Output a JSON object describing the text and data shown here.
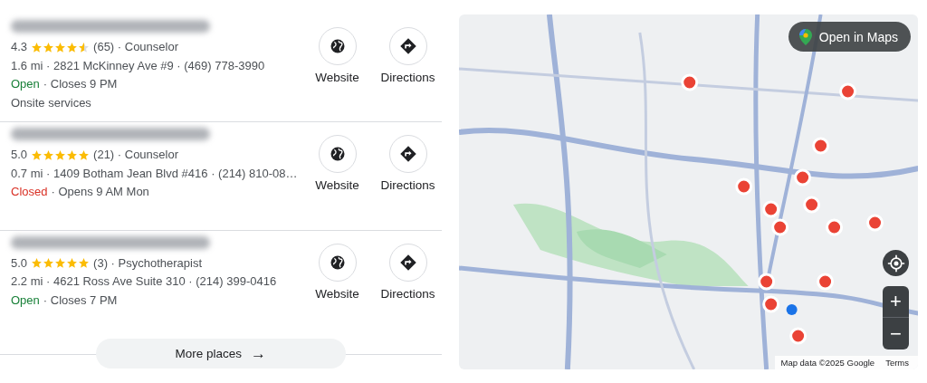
{
  "places": [
    {
      "rating": "4.3",
      "stars": 4.5,
      "reviews": "(65) · Counselor",
      "details": "1.6 mi · 2821 McKinney Ave #9 · (469) 778-3990",
      "open": true,
      "status": "Open",
      "hours": "· Closes 9 PM",
      "extra": "Onsite services",
      "actions": [
        "Website",
        "Directions"
      ]
    },
    {
      "rating": "5.0",
      "stars": 5,
      "reviews": "(21) · Counselor",
      "details": "0.7 mi · 1409 Botham Jean Blvd #416 · (214) 810-08…",
      "open": false,
      "status": "Closed",
      "hours": "· Opens 9 AM Mon",
      "actions": [
        "Website",
        "Directions"
      ]
    },
    {
      "rating": "5.0",
      "stars": 5,
      "reviews": "(3) · Psychotherapist",
      "details": "2.2 mi · 4621 Ross Ave Suite 310 · (214) 399-0416",
      "open": true,
      "status": "Open",
      "hours": "· Closes 7 PM",
      "actions": [
        "Website",
        "Directions"
      ]
    }
  ],
  "more_button": {
    "label": "More places",
    "arrow": "→"
  },
  "map": {
    "open_button": "Open in Maps",
    "zoom_in": "+",
    "zoom_out": "−",
    "attribution": "Map data ©2025 Google",
    "terms": "Terms"
  }
}
